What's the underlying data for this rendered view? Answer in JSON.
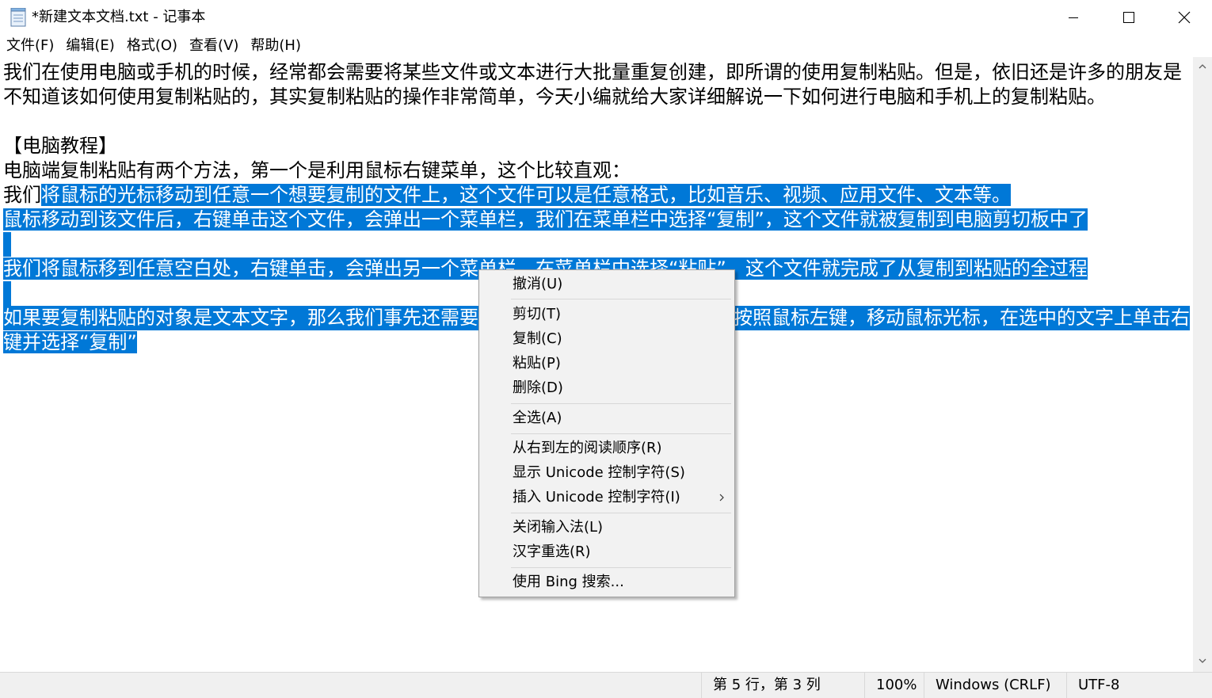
{
  "window": {
    "title": "*新建文本文档.txt - 记事本",
    "controls": {
      "minimize": "minimize-icon",
      "maximize": "maximize-icon",
      "close": "close-icon"
    }
  },
  "menubar": [
    "文件(F)",
    "编辑(E)",
    "格式(O)",
    "查看(V)",
    "帮助(H)"
  ],
  "editor": {
    "lines": [
      "我们在使用电脑或手机的时候，经常都会需要将某些文件或文本进行大批量重复创建，即所谓的使用复制粘贴。但是，依旧还是许多的朋友是",
      "不知道该如何使用复制粘贴的，其实复制粘贴的操作非常简单，今天小编就给大家详细解说一下如何进行电脑和手机上的复制粘贴。",
      "",
      "【电脑教程】",
      "电脑端复制粘贴有两个方法，第一个是利用鼠标右键菜单，这个比较直观：",
      "我们",
      "将鼠标的光标移动到任意一个想要复制的文件上，这个文件可以是任意格式，比如音乐、视频、应用文件、文本等。",
      "鼠标移动到该文件后，右键单击这个文件，会弹出一个菜单栏，我们在菜单栏中选择“复制”，这个文件就被复制到电脑剪切板中了",
      "我们将鼠标移到任意空白处，右键单击，会弹出另一个菜单栏，在菜单栏中选择“粘贴”，这个文件就完成了从复制到粘贴的全过程",
      "如果要复制粘贴的对象是文本文字，那么我们事先还需要",
      "按照鼠标左键，移动鼠标光标，在选中的文字上单击右",
      "键并选择“复制”"
    ]
  },
  "context_menu": {
    "items": [
      "撤消(U)",
      "剪切(T)",
      "复制(C)",
      "粘贴(P)",
      "删除(D)",
      "全选(A)",
      "从右到左的阅读顺序(R)",
      "显示 Unicode 控制字符(S)",
      "插入 Unicode 控制字符(I)",
      "关闭输入法(L)",
      "汉字重选(R)",
      "使用 Bing 搜索..."
    ]
  },
  "statusbar": {
    "position": "第 5 行，第 3 列",
    "zoom": "100%",
    "line_ending": "Windows (CRLF)",
    "encoding": "UTF-8"
  },
  "colors": {
    "selection": "#0078d7",
    "menu_bg": "#f2f2f2",
    "status_bg": "#f0f0f0"
  }
}
